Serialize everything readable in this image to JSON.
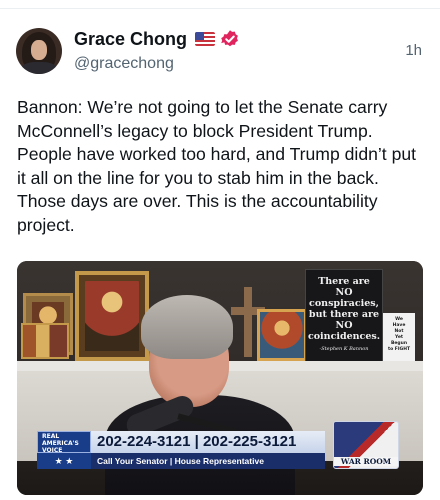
{
  "post": {
    "author": {
      "display_name": "Grace Chong",
      "handle": "@gracechong",
      "badges": [
        "us-flag-icon",
        "verified-icon"
      ]
    },
    "time": "1h",
    "text": "Bannon: We’re not going to let the Senate carry McConnell’s legacy to block President Trump. People have worked too hard, and Trump didn’t put it all on the line for you to stab him in the back. Those days are over. This is the accountability project.",
    "media": {
      "sign_black_lines": [
        "There are",
        "NO",
        "conspiracies,",
        "but there are",
        "NO",
        "coincidences."
      ],
      "sign_black_author": "-Stephen K Bannon",
      "sign_white_lines": [
        "We",
        "Have",
        "Not",
        "Yet",
        "Begun",
        "to FIGHT"
      ],
      "channel_badge_lines": [
        "REAL",
        "AMERICA'S",
        "VOICE"
      ],
      "phone_numbers": "202-224-3121 | 202-225-3121",
      "call_strip": "Call Your Senator | House Representative",
      "logo_label": "WAR ROOM"
    }
  },
  "colors": {
    "text_primary": "#0f1419",
    "text_secondary": "#536471",
    "verified": "#e0245e",
    "lower_third_blue": "#1a2e6a"
  }
}
